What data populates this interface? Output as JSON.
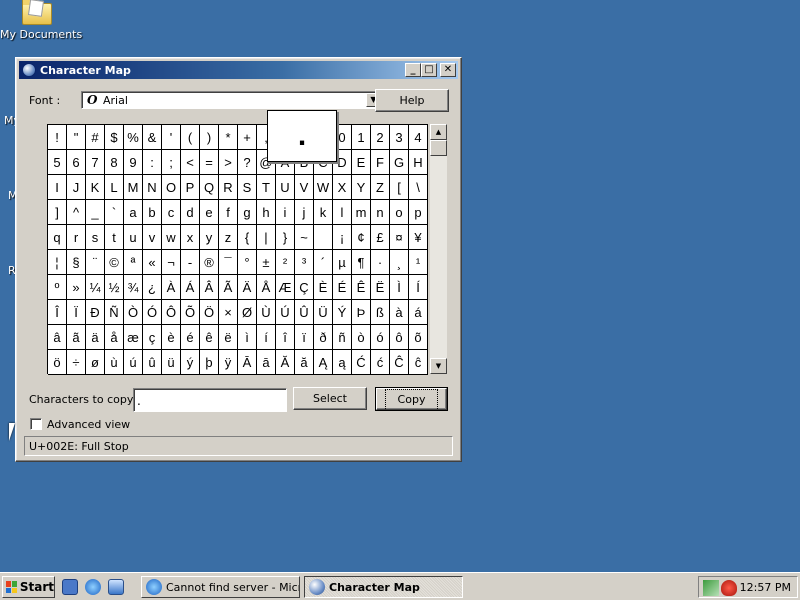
{
  "desktop": {
    "icons": [
      {
        "label": "My Documents"
      }
    ],
    "fragments": [
      "My",
      "M",
      "R"
    ]
  },
  "window": {
    "title": "Character Map",
    "font_label": "Font :",
    "font_value": "Arial",
    "help_label": "Help",
    "characters": [
      [
        "!",
        "\"",
        "#",
        "$",
        "%",
        "&",
        "'",
        "(",
        ")",
        "*",
        "+",
        ",",
        "-",
        ".",
        "/",
        "0",
        "1",
        "2",
        "3",
        "4"
      ],
      [
        "5",
        "6",
        "7",
        "8",
        "9",
        ":",
        ";",
        "<",
        "=",
        ">",
        "?",
        "@",
        "A",
        "B",
        "C",
        "D",
        "E",
        "F",
        "G",
        "H"
      ],
      [
        "I",
        "J",
        "K",
        "L",
        "M",
        "N",
        "O",
        "P",
        "Q",
        "R",
        "S",
        "T",
        "U",
        "V",
        "W",
        "X",
        "Y",
        "Z",
        "[",
        "\\"
      ],
      [
        "]",
        "^",
        "_",
        "`",
        "a",
        "b",
        "c",
        "d",
        "e",
        "f",
        "g",
        "h",
        "i",
        "j",
        "k",
        "l",
        "m",
        "n",
        "o",
        "p"
      ],
      [
        "q",
        "r",
        "s",
        "t",
        "u",
        "v",
        "w",
        "x",
        "y",
        "z",
        "{",
        "|",
        "}",
        "~",
        " ",
        "¡",
        "¢",
        "£",
        "¤",
        "¥"
      ],
      [
        "¦",
        "§",
        "¨",
        "©",
        "ª",
        "«",
        "¬",
        "-",
        "®",
        "¯",
        "°",
        "±",
        "²",
        "³",
        "´",
        "µ",
        "¶",
        "·",
        "¸",
        "¹"
      ],
      [
        "º",
        "»",
        "¼",
        "½",
        "¾",
        "¿",
        "À",
        "Á",
        "Â",
        "Ã",
        "Ä",
        "Å",
        "Æ",
        "Ç",
        "È",
        "É",
        "Ê",
        "Ë",
        "Ì",
        "Í"
      ],
      [
        "Î",
        "Ï",
        "Ð",
        "Ñ",
        "Ò",
        "Ó",
        "Ô",
        "Õ",
        "Ö",
        "×",
        "Ø",
        "Ù",
        "Ú",
        "Û",
        "Ü",
        "Ý",
        "Þ",
        "ß",
        "à",
        "á"
      ],
      [
        "â",
        "ã",
        "ä",
        "å",
        "æ",
        "ç",
        "è",
        "é",
        "ê",
        "ë",
        "ì",
        "í",
        "î",
        "ï",
        "ð",
        "ñ",
        "ò",
        "ó",
        "ô",
        "õ"
      ],
      [
        "ö",
        "÷",
        "ø",
        "ù",
        "ú",
        "û",
        "ü",
        "ý",
        "þ",
        "ÿ",
        "Ā",
        "ā",
        "Ă",
        "ă",
        "Ą",
        "ą",
        "Ć",
        "ć",
        "Ĉ",
        "ĉ"
      ]
    ],
    "magnified_char": ".",
    "copy_label": "Characters to copy :",
    "copy_value": ".",
    "select_label": "Select",
    "copy_button_label": "Copy",
    "advanced_view_label": "Advanced view",
    "status_text": "U+002E: Full Stop"
  },
  "taskbar": {
    "start_label": "Start",
    "tasks": [
      {
        "label": "Cannot find server - Micr...",
        "active": false
      },
      {
        "label": "Character Map",
        "active": true
      }
    ],
    "clock": "12:57 PM"
  }
}
